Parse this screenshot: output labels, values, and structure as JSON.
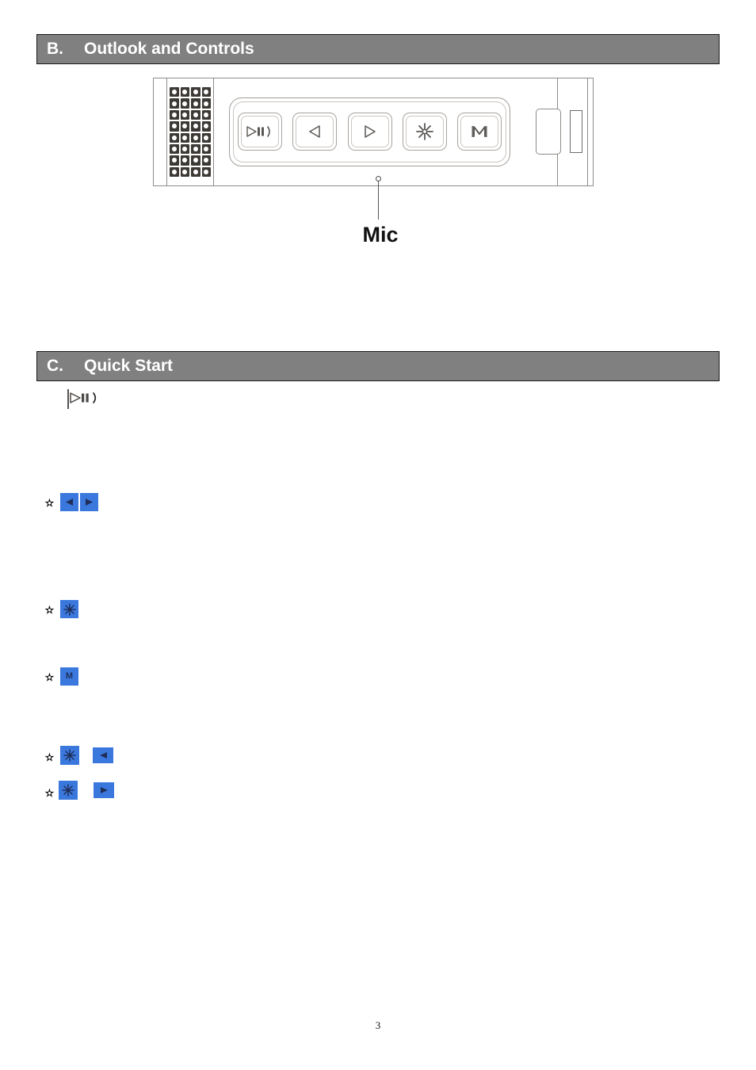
{
  "document": {
    "page_number": "3"
  },
  "sections": [
    {
      "letter": "B.",
      "title": "Outlook and Controls"
    },
    {
      "letter": "C.",
      "title": "Quick Start"
    }
  ],
  "theme": {
    "header_bar_color": "#808080",
    "header_text_color": "#ffffff",
    "key_icon_color": "#3b78de",
    "key_glyph_color": "#1f2f5a",
    "device_outline_color": "#8f8c88"
  },
  "device": {
    "callout_label": "Mic",
    "buttons": [
      {
        "icon": "play-pause-speaker-icon",
        "name": "play-pause"
      },
      {
        "icon": "triangle-left-icon",
        "name": "previous"
      },
      {
        "icon": "triangle-right-icon",
        "name": "next"
      },
      {
        "icon": "asterisk-light-icon",
        "name": "light"
      },
      {
        "icon": "letter-m-icon",
        "name": "mode"
      }
    ],
    "speaker_grille": {
      "columns": 4,
      "rows": 8
    }
  },
  "quick_start": {
    "figures": [
      {
        "id": "figure-play-pause",
        "icons": [
          {
            "icon": "play-pause-speaker-icon",
            "label": ""
          }
        ]
      },
      {
        "id": "figure-prev-next",
        "icons": [
          {
            "icon": "triangle-left-icon",
            "label": ""
          },
          {
            "icon": "triangle-right-icon",
            "label": ""
          }
        ]
      },
      {
        "id": "figure-light",
        "icons": [
          {
            "icon": "asterisk-light-icon",
            "label": ""
          }
        ]
      },
      {
        "id": "figure-mode",
        "icons": [
          {
            "icon": "letter-m-icon",
            "label": "M"
          }
        ]
      },
      {
        "id": "figure-light-prev",
        "icons": [
          {
            "icon": "asterisk-light-icon",
            "label": ""
          },
          {
            "icon": "triangle-left-icon",
            "label": ""
          }
        ]
      },
      {
        "id": "figure-light-next",
        "icons": [
          {
            "icon": "asterisk-light-icon",
            "label": ""
          },
          {
            "icon": "triangle-right-icon",
            "label": ""
          }
        ]
      }
    ]
  }
}
